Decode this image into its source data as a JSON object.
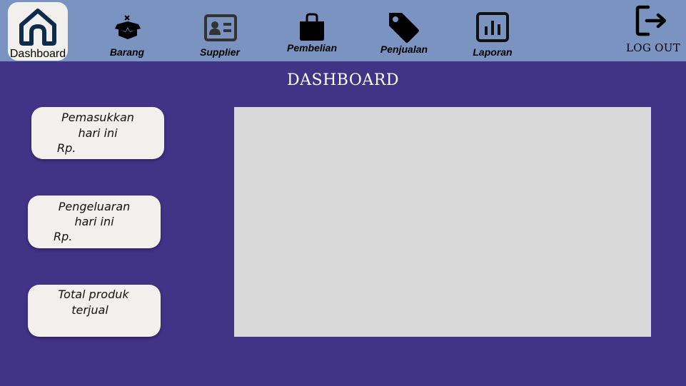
{
  "nav": {
    "items": [
      {
        "label": "Dashboard",
        "icon": "home-icon",
        "active": true
      },
      {
        "label": "Barang",
        "icon": "box-icon"
      },
      {
        "label": "Supplier",
        "icon": "id-card-icon"
      },
      {
        "label": "Pembelian",
        "icon": "shopping-bag-icon"
      },
      {
        "label": "Penjualan",
        "icon": "price-tag-icon"
      },
      {
        "label": "Laporan",
        "icon": "bar-chart-icon"
      }
    ],
    "logout_label": "LOG OUT",
    "logout_icon": "logout-icon"
  },
  "page": {
    "title": "DASHBOARD"
  },
  "cards": [
    {
      "title_line1": "Pemasukkan",
      "title_line2": "hari ini",
      "value": "Rp."
    },
    {
      "title_line1": "Pengeluaran",
      "title_line2": "hari ini",
      "value": "Rp."
    },
    {
      "title_line1": "Total produk",
      "title_line2": "terjual"
    }
  ],
  "colors": {
    "background": "#413386",
    "topbar": "#7a93c0",
    "card": "#f1f0ed",
    "panel": "#d9d9d9",
    "icon": "#000000",
    "home_icon": "#0f2b4c"
  }
}
